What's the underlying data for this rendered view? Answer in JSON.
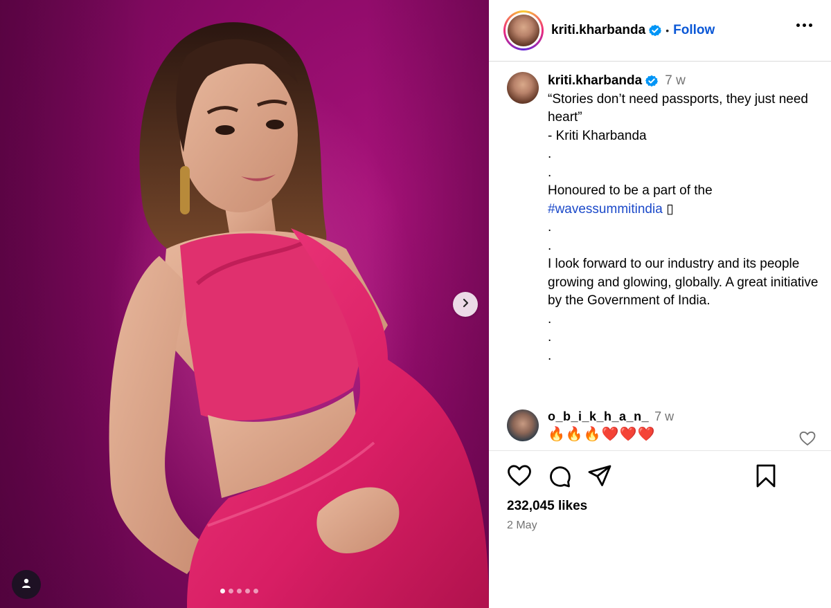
{
  "media": {
    "carousel_count": 5,
    "carousel_active_index": 0,
    "colors": {
      "backdrop": "#8a0a66",
      "saree": "#e0226b"
    }
  },
  "header": {
    "username": "kriti.kharbanda",
    "verified": true,
    "separator": "•",
    "follow_label": "Follow"
  },
  "caption": {
    "username": "kriti.kharbanda",
    "time": "7 w",
    "lines": [
      "“Stories don’t need passports, they just need heart”",
      "- Kriti Kharbanda",
      ".",
      ".",
      "Honoured to be a part of the"
    ],
    "hashtag": "#wavessummitindia",
    "hashtag_suffix": " ▯",
    "lines_after": [
      ".",
      ".",
      "I look forward to our industry and its people growing and glowing, globally. A great initiative by the Government of India.",
      ".",
      ".",
      "."
    ]
  },
  "comment": {
    "username": "o_b_i_k_h_a_n_",
    "time": "7 w",
    "text": "🔥🔥🔥❤️❤️❤️"
  },
  "stats": {
    "likes": "232,045 likes",
    "date": "2 May"
  },
  "icons": {
    "like": "heart-icon",
    "comment": "comment-icon",
    "share": "share-icon",
    "save": "bookmark-icon"
  },
  "theme": {
    "link": "#0a57d6",
    "hashtag": "#1b49c9",
    "muted": "#737373"
  }
}
